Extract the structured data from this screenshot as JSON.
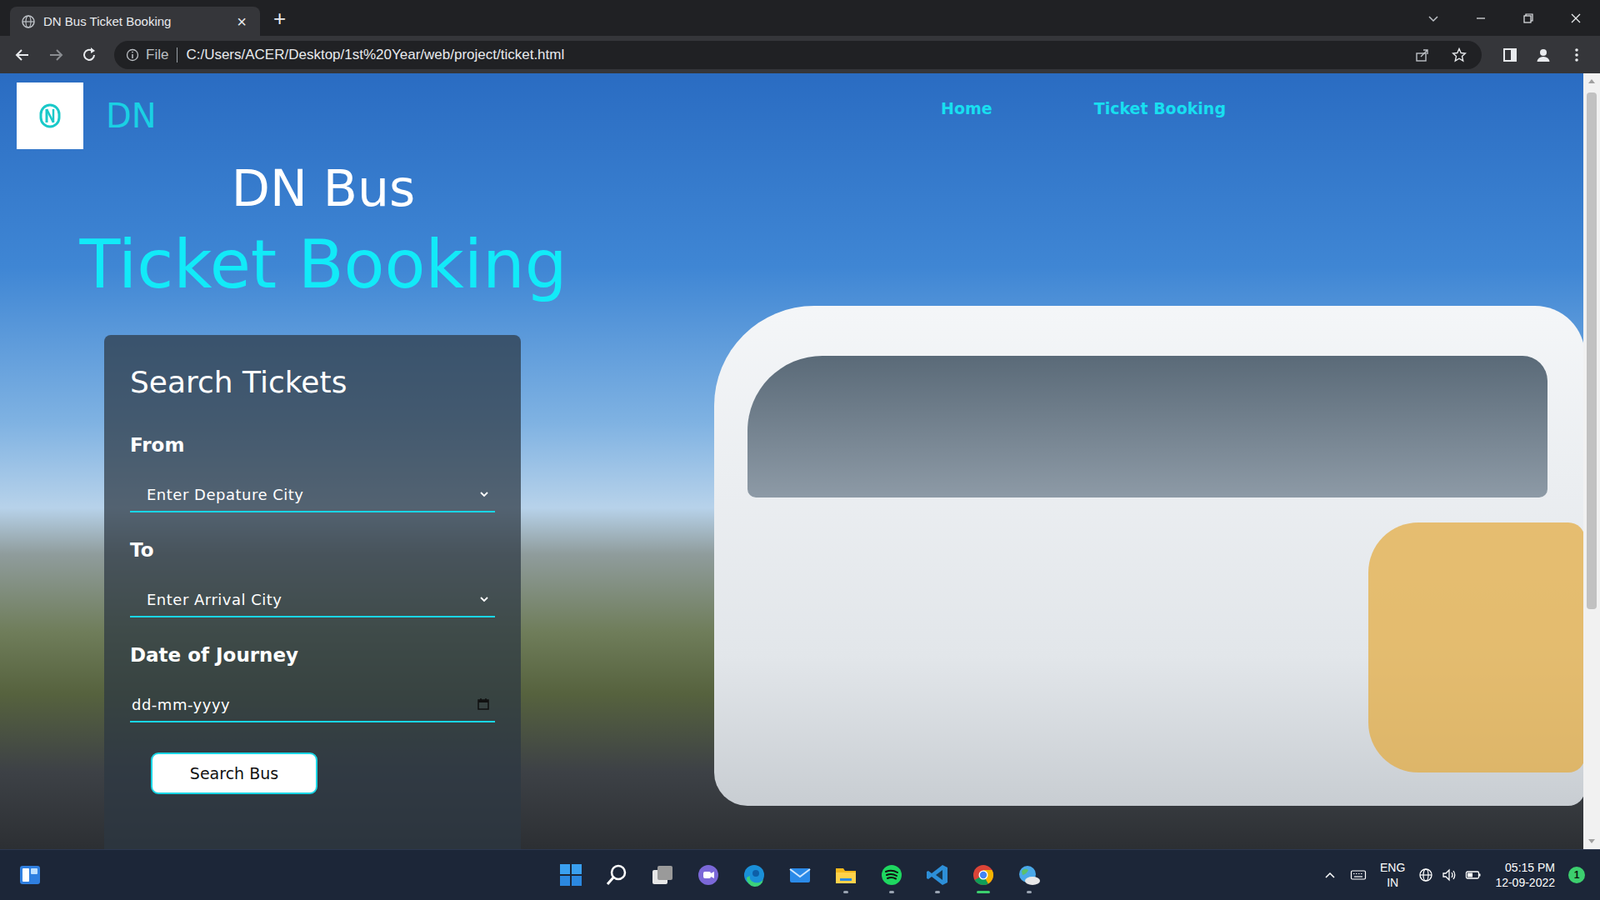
{
  "window": {
    "title": "DN Bus Ticket Booking"
  },
  "browser": {
    "tabs": [
      {
        "label": "DN Bus Ticket Booking",
        "selected": true,
        "close": "×"
      }
    ],
    "new_tab": "+",
    "address": {
      "scheme": "File",
      "url": "C:/Users/ACER/Desktop/1st%20Year/web/project/ticket.html"
    }
  },
  "page": {
    "brand": "DN",
    "nav": [
      {
        "label": "Home"
      },
      {
        "label": "Ticket Booking"
      }
    ],
    "hero": {
      "line1": "DN Bus",
      "line2": "Ticket Booking"
    },
    "form": {
      "title": "Search Tickets",
      "fields": [
        {
          "label": "From",
          "kind": "select",
          "placeholder": "Enter Depature City"
        },
        {
          "label": "To",
          "kind": "select",
          "placeholder": "Enter Arrival City"
        },
        {
          "label": "Date of Journey",
          "kind": "date",
          "placeholder": "dd-mm-yyyy"
        }
      ],
      "button": "Search Bus"
    }
  },
  "taskbar": {
    "apps": [
      {
        "running": false,
        "active": false
      },
      {
        "running": false,
        "active": false
      },
      {
        "running": false,
        "active": false
      },
      {
        "running": false,
        "active": false
      },
      {
        "running": false,
        "active": false
      },
      {
        "running": false,
        "active": false
      },
      {
        "running": true,
        "active": false
      },
      {
        "running": true,
        "active": false
      },
      {
        "running": true,
        "active": false
      },
      {
        "running": true,
        "active": true
      },
      {
        "running": true,
        "active": false
      }
    ],
    "tray": {
      "language": "ENG",
      "region": "IN",
      "time": "05:15 PM",
      "date": "12-09-2022",
      "notifications": "1"
    }
  }
}
